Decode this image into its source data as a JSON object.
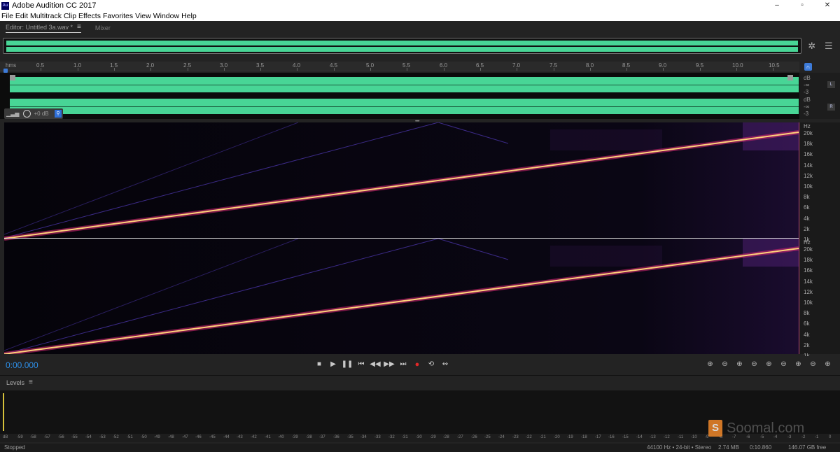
{
  "app": {
    "title": "Adobe Audition CC 2017",
    "icon_text": "Au"
  },
  "window_controls": {
    "minimize": "–",
    "maximize": "▫",
    "close": "✕"
  },
  "menu": [
    "File",
    "Edit",
    "Multitrack",
    "Clip",
    "Effects",
    "Favorites",
    "View",
    "Window",
    "Help"
  ],
  "panel_tabs": {
    "editor": "Editor: Untitled 3a.wav *",
    "mixer": "Mixer"
  },
  "ruler": {
    "unit": "hms",
    "labels": [
      "0.5",
      "1.0",
      "1.5",
      "2.0",
      "2.5",
      "3.0",
      "3.5",
      "4.0",
      "4.5",
      "5.0",
      "5.5",
      "6.0",
      "6.5",
      "7.0",
      "7.5",
      "8.0",
      "8.5",
      "9.0",
      "9.5",
      "10.0",
      "10.5"
    ]
  },
  "waveform_scale": {
    "left": {
      "db": "dB",
      "inf": "-∞",
      "neg3": "-3",
      "badge": "L"
    },
    "right": {
      "db": "dB",
      "inf": "-∞",
      "neg3": "-3",
      "badge": "R"
    }
  },
  "hud": {
    "value": "+0 dB"
  },
  "frequency_scale": {
    "unit": "Hz",
    "labels": [
      "20k",
      "18k",
      "16k",
      "14k",
      "12k",
      "10k",
      "8k",
      "6k",
      "4k",
      "2k",
      "1k"
    ]
  },
  "colors": {
    "waveform": "#48d596",
    "sweep": "#ffd27a",
    "accent": "#2e8fe8",
    "record": "#e12828"
  },
  "transport": {
    "time": "0:00.000",
    "buttons": {
      "stop": "■",
      "play": "▶",
      "pause": "❚❚",
      "to_start": "⏮",
      "rewind": "◀◀",
      "forward": "▶▶",
      "to_end": "⏭",
      "record": "●",
      "loop": "⟲",
      "skip": "↭"
    }
  },
  "zoom": [
    "⊕",
    "⊖",
    "⊕",
    "⊖",
    "⊕",
    "⊖",
    "⊕",
    "⊖",
    "⊕",
    "⊖",
    "⊕"
  ],
  "levels": {
    "title": "Levels",
    "scale": [
      "dB",
      "-59",
      "-58",
      "-57",
      "-56",
      "-55",
      "-54",
      "-53",
      "-52",
      "-51",
      "-50",
      "-49",
      "-48",
      "-47",
      "-46",
      "-45",
      "-44",
      "-43",
      "-42",
      "-41",
      "-40",
      "-39",
      "-38",
      "-37",
      "-36",
      "-35",
      "-34",
      "-33",
      "-32",
      "-31",
      "-30",
      "-29",
      "-28",
      "-27",
      "-26",
      "-25",
      "-24",
      "-23",
      "-22",
      "-21",
      "-20",
      "-19",
      "-18",
      "-17",
      "-16",
      "-15",
      "-14",
      "-13",
      "-12",
      "-11",
      "-10",
      "-9",
      "-8",
      "-7",
      "-6",
      "-5",
      "-4",
      "-3",
      "-2",
      "-1",
      "0"
    ]
  },
  "watermark": {
    "logo": "S",
    "text": "Soomal.com"
  },
  "status": {
    "state": "Stopped",
    "sample_info": "44100 Hz • 24-bit • Stereo",
    "file_size": "2.74 MB",
    "duration": "0:10.860",
    "free_space": "146.07 GB free"
  }
}
